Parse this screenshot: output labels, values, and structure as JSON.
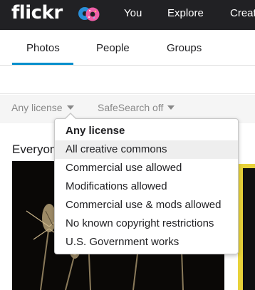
{
  "topbar": {
    "logo": "flickr",
    "nav": {
      "you": "You",
      "explore": "Explore",
      "create": "Create"
    }
  },
  "subnav": {
    "tabs": [
      "Photos",
      "People",
      "Groups"
    ],
    "active_tab": "Photos"
  },
  "filters": {
    "license": "Any license",
    "safesearch": "SafeSearch off"
  },
  "section": {
    "title": "Everyone's photos"
  },
  "license_menu": {
    "options": [
      "Any license",
      "All creative commons",
      "Commercial use allowed",
      "Modifications allowed",
      "Commercial use & mods allowed",
      "No known copyright restrictions",
      "U.S. Government works"
    ],
    "selected": "Any license",
    "hovered": "All creative commons"
  },
  "colors": {
    "topbar_bg": "#212124",
    "accent_blue": "#008ecc",
    "muted_text": "#898989",
    "filter_bar_bg": "#f5f5f5",
    "hover_bg": "#eeeeee"
  },
  "icons": [
    "donut-logo-icon",
    "caret-down-icon"
  ]
}
